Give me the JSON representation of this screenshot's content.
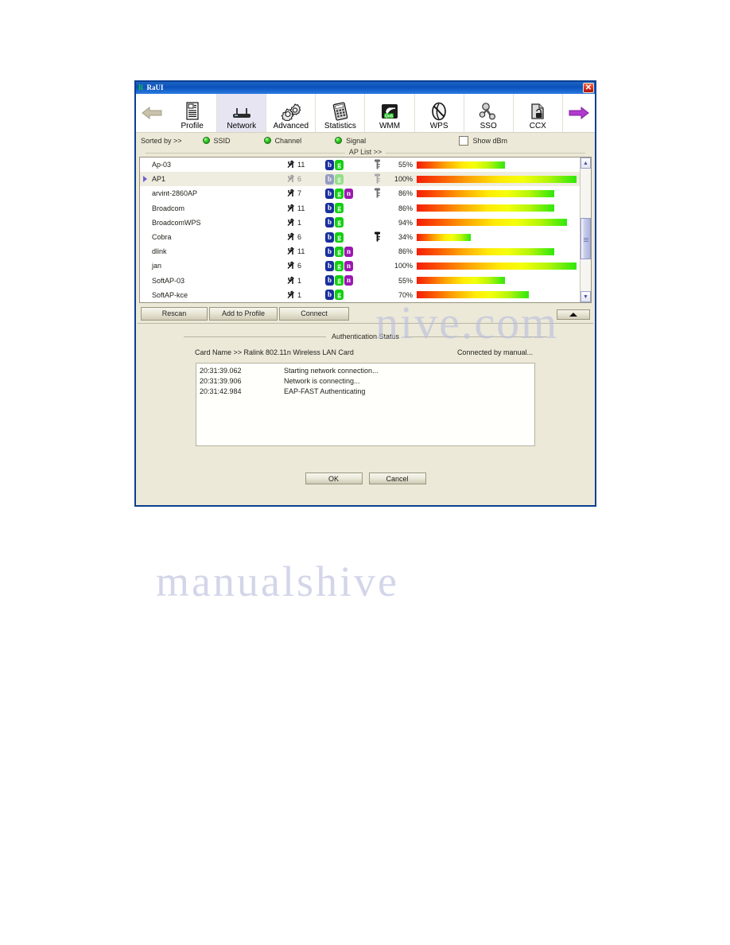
{
  "window": {
    "title": "RaUI",
    "title_icon": "ralink-logo-icon",
    "close_label": "✕"
  },
  "toolbar": {
    "prev_arrow_icon": "arrow-left-icon",
    "next_arrow_icon": "arrow-right-icon",
    "tabs": [
      {
        "label": "Profile",
        "icon": "profile-icon",
        "active": false
      },
      {
        "label": "Network",
        "icon": "router-icon",
        "active": true
      },
      {
        "label": "Advanced",
        "icon": "gears-icon",
        "active": false
      },
      {
        "label": "Statistics",
        "icon": "calculator-icon",
        "active": false
      },
      {
        "label": "WMM",
        "icon": "qos-icon",
        "active": false
      },
      {
        "label": "WPS",
        "icon": "wps-icon",
        "active": false
      },
      {
        "label": "SSO",
        "icon": "sso-key-icon",
        "active": false
      },
      {
        "label": "CCX",
        "icon": "ccx-lock-icon",
        "active": false
      }
    ]
  },
  "sortbar": {
    "label": "Sorted by >>",
    "options": [
      {
        "label": "SSID",
        "icon": "green-led-icon"
      },
      {
        "label": "Channel",
        "icon": "green-led-icon"
      },
      {
        "label": "Signal",
        "icon": "green-led-icon"
      }
    ],
    "show_dbm_label": "Show dBm",
    "show_dbm_checked": false,
    "aplist_caption": "AP List >>"
  },
  "ap_list": {
    "rows": [
      {
        "ssid": "Ap-03",
        "channel": "11",
        "bands": [
          "b",
          "g"
        ],
        "lock": "key-gray",
        "percent": "55%",
        "value": 55,
        "selected": false
      },
      {
        "ssid": "AP1",
        "channel": "6",
        "bands": [
          "b",
          "g"
        ],
        "lock": "key-gray",
        "percent": "100%",
        "value": 100,
        "selected": true,
        "dim": true
      },
      {
        "ssid": "arvint-2860AP",
        "channel": "7",
        "bands": [
          "b",
          "g",
          "n"
        ],
        "lock": "key-gray",
        "percent": "86%",
        "value": 86,
        "selected": false
      },
      {
        "ssid": "Broadcom",
        "channel": "11",
        "bands": [
          "b",
          "g"
        ],
        "lock": "",
        "percent": "86%",
        "value": 86,
        "selected": false
      },
      {
        "ssid": "BroadcomWPS",
        "channel": "1",
        "bands": [
          "b",
          "g"
        ],
        "lock": "",
        "percent": "94%",
        "value": 94,
        "selected": false
      },
      {
        "ssid": "Cobra",
        "channel": "6",
        "bands": [
          "b",
          "g"
        ],
        "lock": "key-black",
        "percent": "34%",
        "value": 34,
        "selected": false
      },
      {
        "ssid": "dlink",
        "channel": "11",
        "bands": [
          "b",
          "g",
          "n"
        ],
        "lock": "",
        "percent": "86%",
        "value": 86,
        "selected": false
      },
      {
        "ssid": "jan",
        "channel": "6",
        "bands": [
          "b",
          "g",
          "n"
        ],
        "lock": "",
        "percent": "100%",
        "value": 100,
        "selected": false
      },
      {
        "ssid": "SoftAP-03",
        "channel": "1",
        "bands": [
          "b",
          "g",
          "n"
        ],
        "lock": "",
        "percent": "55%",
        "value": 55,
        "selected": false
      },
      {
        "ssid": "SoftAP-kce",
        "channel": "1",
        "bands": [
          "b",
          "g"
        ],
        "lock": "",
        "percent": "70%",
        "value": 70,
        "selected": false
      }
    ],
    "scrollbar": {
      "up_icon": "scroll-up-icon",
      "down_icon": "scroll-down-icon"
    }
  },
  "actions": {
    "rescan": "Rescan",
    "add_to_profile": "Add to Profile",
    "connect": "Connect",
    "collapse_icon": "triangle-up-icon"
  },
  "auth": {
    "caption": "Authentication Status",
    "card_name": "Card Name >> Ralink 802.11n Wireless LAN Card",
    "connection_note": "Connected by manual...",
    "log": [
      {
        "time": "20:31:39.062",
        "message": "Starting network connection..."
      },
      {
        "time": "20:31:39.906",
        "message": "Network is connecting..."
      },
      {
        "time": "20:31:42.984",
        "message": "EAP-FAST Authenticating"
      }
    ]
  },
  "footer": {
    "ok": "OK",
    "cancel": "Cancel"
  },
  "watermark": {
    "line1": "nive.com",
    "line2": "manualshive"
  },
  "colors": {
    "titlebar_blue": "#0a51bb",
    "window_border": "#0a3f91",
    "dialog_face": "#ece9d8",
    "active_tab": "#e8e5f2",
    "led_green": "#37d327",
    "badge_b": "#1a2f9c",
    "badge_g": "#13cf13",
    "badge_n": "#9b18b0",
    "signal_start": "#f51d06",
    "signal_end": "#2ee80c"
  }
}
